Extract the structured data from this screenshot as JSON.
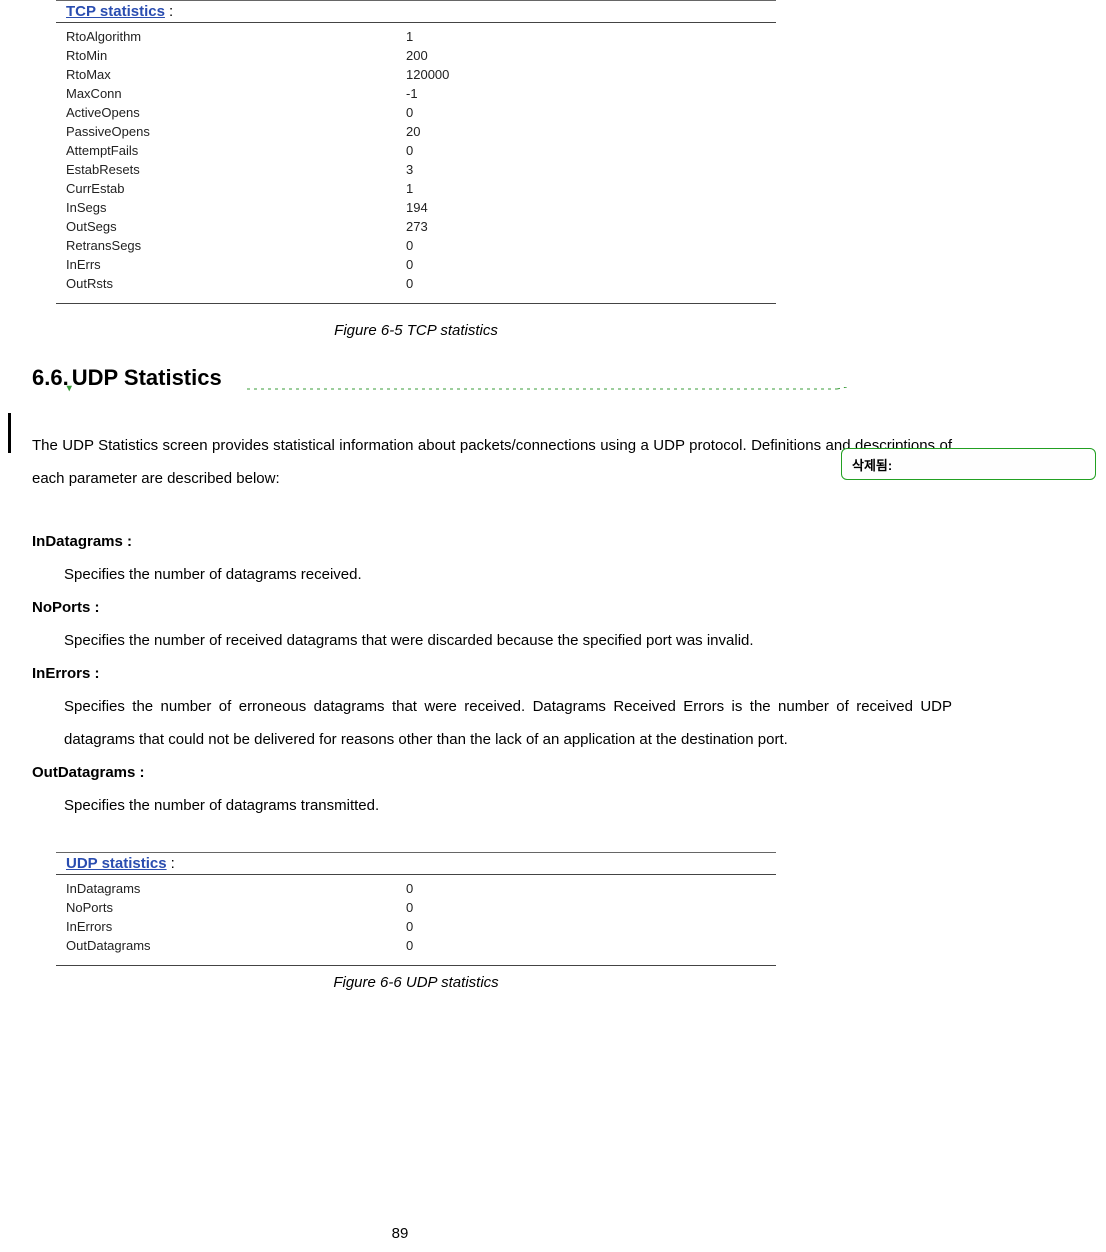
{
  "tcp_panel": {
    "title": "TCP statistics",
    "colon": " :",
    "rows": [
      {
        "k": "RtoAlgorithm",
        "v": "1"
      },
      {
        "k": "RtoMin",
        "v": "200"
      },
      {
        "k": "RtoMax",
        "v": "120000"
      },
      {
        "k": "MaxConn",
        "v": "-1"
      },
      {
        "k": "ActiveOpens",
        "v": "0"
      },
      {
        "k": "PassiveOpens",
        "v": "20"
      },
      {
        "k": "AttemptFails",
        "v": "0"
      },
      {
        "k": "EstabResets",
        "v": "3"
      },
      {
        "k": "CurrEstab",
        "v": "1"
      },
      {
        "k": "InSegs",
        "v": "194"
      },
      {
        "k": "OutSegs",
        "v": "273"
      },
      {
        "k": "RetransSegs",
        "v": "0"
      },
      {
        "k": "InErrs",
        "v": "0"
      },
      {
        "k": "OutRsts",
        "v": "0"
      }
    ]
  },
  "figure_tcp": "Figure 6-5 TCP statistics",
  "section": {
    "num": "6.6.",
    "title": "UDP Statistics"
  },
  "comment": {
    "label": "삭제됨:"
  },
  "body": "The UDP Statistics screen provides statistical information about packets/connections using a UDP protocol. Definitions and descriptions of each parameter are described below:",
  "defs": [
    {
      "term": "InDatagrams :",
      "desc": "Specifies the number of datagrams received."
    },
    {
      "term": "NoPorts :",
      "desc": "Specifies the number of received datagrams that were discarded because the specified port was invalid."
    },
    {
      "term": "InErrors :",
      "desc": "Specifies the number of erroneous datagrams that were received. Datagrams Received Errors is the number of received UDP datagrams that could not be delivered for reasons other than the lack of an application at the destination port."
    },
    {
      "term": "OutDatagrams :",
      "desc": "Specifies the number of datagrams transmitted."
    }
  ],
  "udp_panel": {
    "title": "UDP statistics",
    "colon": " :",
    "rows": [
      {
        "k": "InDatagrams",
        "v": "0"
      },
      {
        "k": "NoPorts",
        "v": "0"
      },
      {
        "k": "InErrors",
        "v": "0"
      },
      {
        "k": "OutDatagrams",
        "v": "0"
      }
    ]
  },
  "figure_udp": "Figure 6-6 UDP statistics",
  "page_number": "89"
}
